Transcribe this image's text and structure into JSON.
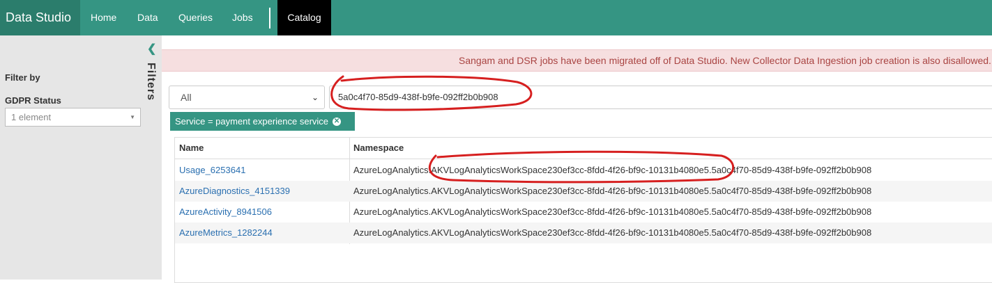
{
  "nav": {
    "brand": "Data Studio",
    "items": [
      "Home",
      "Data",
      "Queries",
      "Jobs"
    ],
    "active": "Catalog"
  },
  "sidebar": {
    "collapse_icon": "chevron-left-icon",
    "filters_label": "Filters",
    "filter_by": "Filter by",
    "gdpr_label": "GDPR Status",
    "gdpr_value": "1 element"
  },
  "alert": {
    "text": "Sangam and DSR jobs have been migrated off of Data Studio. New Collector Data Ingestion job creation is also disallowed. F"
  },
  "search": {
    "scope": "All",
    "query": "5a0c4f70-85d9-438f-b9fe-092ff2b0b908"
  },
  "filter_chip": {
    "label": "Service = payment experience service",
    "remove_icon": "close-circle-icon"
  },
  "table": {
    "headers": [
      "Name",
      "Namespace"
    ],
    "rows": [
      {
        "name": "Usage_6253641",
        "namespace": "AzureLogAnalytics.AKVLogAnalyticsWorkSpace230ef3cc-8fdd-4f26-bf9c-10131b4080e5.5a0c4f70-85d9-438f-b9fe-092ff2b0b908"
      },
      {
        "name": "AzureDiagnostics_4151339",
        "namespace": "AzureLogAnalytics.AKVLogAnalyticsWorkSpace230ef3cc-8fdd-4f26-bf9c-10131b4080e5.5a0c4f70-85d9-438f-b9fe-092ff2b0b908"
      },
      {
        "name": "AzureActivity_8941506",
        "namespace": "AzureLogAnalytics.AKVLogAnalyticsWorkSpace230ef3cc-8fdd-4f26-bf9c-10131b4080e5.5a0c4f70-85d9-438f-b9fe-092ff2b0b908"
      },
      {
        "name": "AzureMetrics_1282244",
        "namespace": "AzureLogAnalytics.AKVLogAnalyticsWorkSpace230ef3cc-8fdd-4f26-bf9c-10131b4080e5.5a0c4f70-85d9-438f-b9fe-092ff2b0b908"
      }
    ]
  },
  "colors": {
    "nav_bg": "#359583",
    "brand_bg": "#2b7d6c",
    "active_tab_bg": "#000000",
    "alert_text": "#a94442",
    "link": "#2a6fb0",
    "annotation": "#d61f1f"
  }
}
